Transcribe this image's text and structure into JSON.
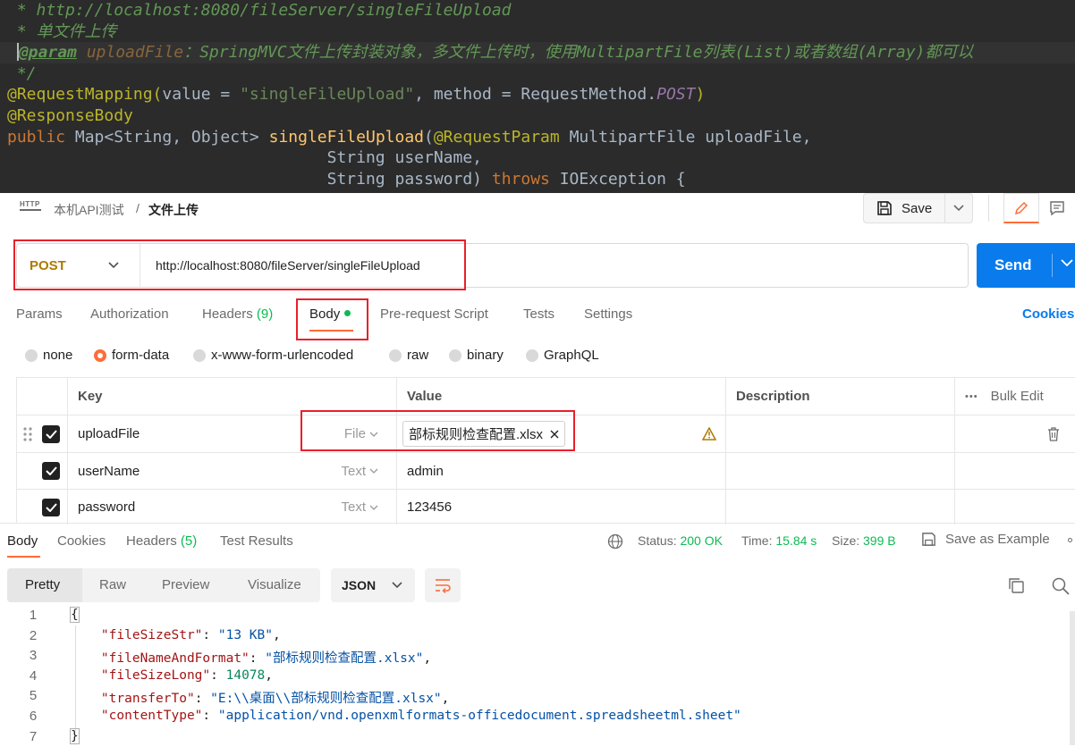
{
  "code_editor": {
    "line1": " * http://localhost:8080/fileServer/singleFileUpload",
    "line2": " * 单文件上传",
    "line3_tag": "@param",
    "line3_param": " uploadFile",
    "line3_desc": "：SpringMVC文件上传封装对象，多文件上传时，使用MultipartFile列表(List)或者数组(Array)都可以",
    "line4": " */",
    "line5_anno": "@RequestMapping(",
    "line5_key1": "value = ",
    "line5_str": "\"singleFileUpload\"",
    "line5_mid": ", method = RequestMethod.",
    "line5_static": "POST",
    "line5_end": ")",
    "line6": "@ResponseBody",
    "line7_kw": "public ",
    "line7_type": "Map<String, Object> ",
    "line7_method": "singleFileUpload",
    "line7_paren": "(",
    "line7_anno": "@RequestParam ",
    "line7_rest": "MultipartFile uploadFile,",
    "line8": "                                 String userName,",
    "line9_a": "                                 String password) ",
    "line9_kw": "throws ",
    "line9_b": "IOException {"
  },
  "header": {
    "http_icon": "HTTP",
    "breadcrumb_parent": "本机API测试",
    "breadcrumb_sep": "/",
    "breadcrumb_current": "文件上传",
    "save_label": "Save"
  },
  "request": {
    "method": "POST",
    "url": "http://localhost:8080/fileServer/singleFileUpload",
    "send_label": "Send"
  },
  "tabs": {
    "params": "Params",
    "authorization": "Authorization",
    "headers": "Headers",
    "headers_count": "(9)",
    "body": "Body",
    "prerequest": "Pre-request Script",
    "tests": "Tests",
    "settings": "Settings",
    "cookies": "Cookies"
  },
  "body_types": {
    "none": "none",
    "form_data": "form-data",
    "urlencoded": "x-www-form-urlencoded",
    "raw": "raw",
    "binary": "binary",
    "graphql": "GraphQL"
  },
  "table": {
    "col_key": "Key",
    "col_value": "Value",
    "col_description": "Description",
    "bulk_edit": "Bulk Edit",
    "more": "•••",
    "rows": [
      {
        "key": "uploadFile",
        "type": "File",
        "value": "部标规则检查配置.xlsx"
      },
      {
        "key": "userName",
        "type": "Text",
        "value": "admin"
      },
      {
        "key": "password",
        "type": "Text",
        "value": "123456"
      }
    ]
  },
  "response": {
    "tab_body": "Body",
    "tab_cookies": "Cookies",
    "tab_headers": "Headers",
    "tab_headers_count": "(5)",
    "tab_tests": "Test Results",
    "status_label": "Status:",
    "status_value": "200 OK",
    "time_label": "Time:",
    "time_value": "15.84 s",
    "size_label": "Size:",
    "size_value": "399 B",
    "save_example": "Save as Example",
    "view_pretty": "Pretty",
    "view_raw": "Raw",
    "view_preview": "Preview",
    "view_visualize": "Visualize",
    "format": "JSON",
    "lines": [
      {
        "n": "1",
        "text": "{"
      },
      {
        "n": "2",
        "key": "\"fileSizeStr\"",
        "val": "\"13 KB\"",
        "kind": "s",
        "comma": ","
      },
      {
        "n": "3",
        "key": "\"fileNameAndFormat\"",
        "val": "\"部标规则检查配置.xlsx\"",
        "kind": "s",
        "comma": ","
      },
      {
        "n": "4",
        "key": "\"fileSizeLong\"",
        "val": "14078",
        "kind": "n",
        "comma": ","
      },
      {
        "n": "5",
        "key": "\"transferTo\"",
        "val": "\"E:\\\\桌面\\\\部标规则检查配置.xlsx\"",
        "kind": "s",
        "comma": ","
      },
      {
        "n": "6",
        "key": "\"contentType\"",
        "val": "\"application/vnd.openxmlformats-officedocument.spreadsheetml.sheet\"",
        "kind": "s",
        "comma": ""
      },
      {
        "n": "7",
        "text": "}"
      }
    ]
  },
  "colors": {
    "accent": "#ff6c37",
    "send_blue": "#097bed",
    "status_green": "#0cbb52",
    "method_post": "#ad7a03",
    "annotation_red": "#e8202a"
  }
}
